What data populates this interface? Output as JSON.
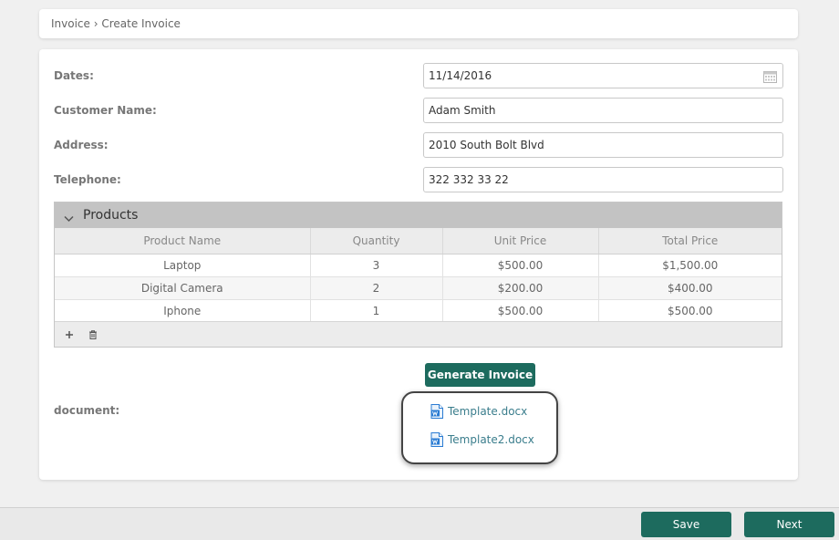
{
  "breadcrumb": "Invoice › Create Invoice",
  "form": {
    "dates": {
      "label": "Dates:",
      "value": "11/14/2016"
    },
    "customer": {
      "label": "Customer Name:",
      "value": "Adam Smith"
    },
    "address": {
      "label": "Address:",
      "value": "2010 South Bolt Blvd"
    },
    "telephone": {
      "label": "Telephone:",
      "value": "322 332 33 22"
    }
  },
  "products": {
    "title": "Products",
    "columns": [
      "Product Name",
      "Quantity",
      "Unit Price",
      "Total Price"
    ],
    "rows": [
      [
        "Laptop",
        "3",
        "$500.00",
        "$1,500.00"
      ],
      [
        "Digital Camera",
        "2",
        "$200.00",
        "$400.00"
      ],
      [
        "Iphone",
        "1",
        "$500.00",
        "$500.00"
      ]
    ]
  },
  "generate_label": "Generate Invoice",
  "document": {
    "label": "document:",
    "files": [
      "Template.docx",
      "Template2.docx"
    ]
  },
  "footer": {
    "save_label": "Save",
    "next_label": "Next"
  },
  "icons": {
    "calendar": "calendar-icon",
    "collapse": "chevron-down-icon",
    "add": "plus-icon",
    "delete": "trash-icon",
    "file": "word-document-icon"
  },
  "colors": {
    "accent": "#1d6b5e",
    "link": "#3a7d8c",
    "word": "#2b7cd3"
  }
}
